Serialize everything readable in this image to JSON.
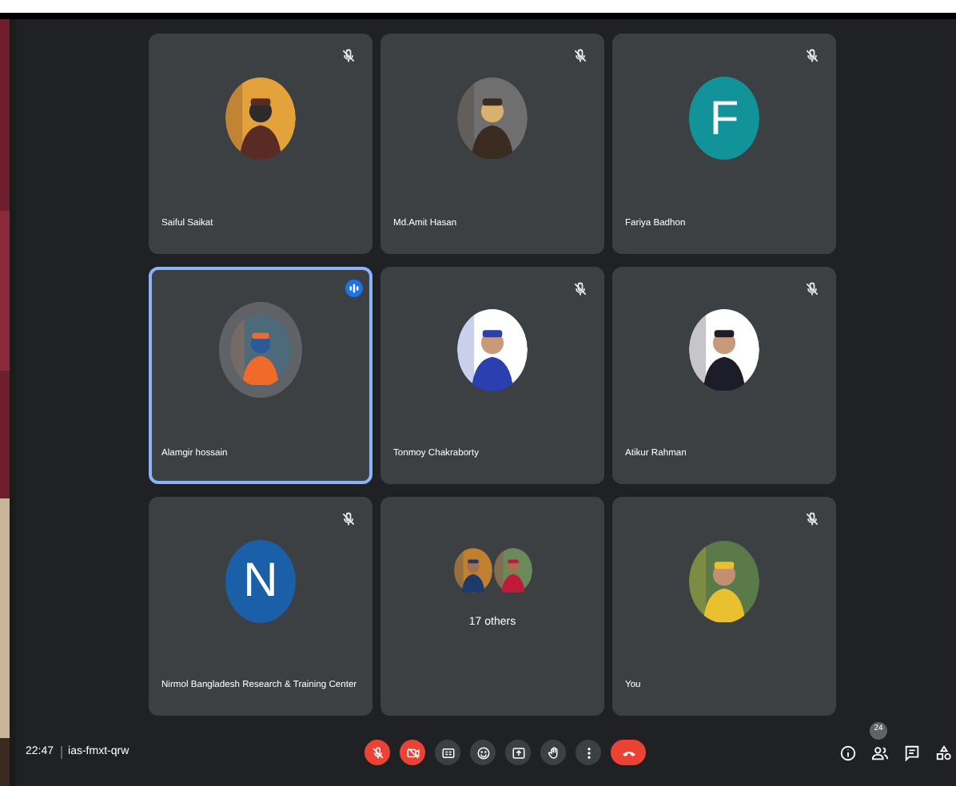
{
  "tiles": [
    {
      "name": "Saiful Saikat",
      "muted": true,
      "speaking": false
    },
    {
      "name": "Md.Amit Hasan",
      "muted": true,
      "speaking": false
    },
    {
      "name": "Fariya Badhon",
      "avatar": {
        "kind": "letter",
        "letter": "F",
        "color": "#12939a"
      },
      "muted": true,
      "speaking": false
    },
    {
      "name": "Alamgir hossain",
      "muted": false,
      "speaking": true
    },
    {
      "name": "Tonmoy Chakraborty",
      "muted": true,
      "speaking": false
    },
    {
      "name": "Atikur Rahman",
      "muted": true,
      "speaking": false
    },
    {
      "name": "Nirmol Bangladesh Research & Training Center",
      "avatar": {
        "kind": "letter",
        "letter": "N",
        "color": "#1a5fa8"
      },
      "muted": true,
      "speaking": false
    },
    {
      "name": "17 others",
      "avatar": {
        "kind": "group"
      },
      "muted": false,
      "speaking": false
    },
    {
      "name": "You",
      "muted": true,
      "speaking": false
    }
  ],
  "bottom_bar": {
    "time": "22:47",
    "meeting_code": "ias-fmxt-qrw",
    "participant_count": "24",
    "controls": [
      {
        "kind": "mic",
        "off": true
      },
      {
        "kind": "camera",
        "off": true
      },
      {
        "kind": "captions",
        "off": false
      },
      {
        "kind": "emoji",
        "off": false
      },
      {
        "kind": "present",
        "off": false
      },
      {
        "kind": "hand",
        "off": false
      },
      {
        "kind": "more",
        "off": false
      },
      {
        "kind": "leave",
        "off": false
      }
    ]
  }
}
